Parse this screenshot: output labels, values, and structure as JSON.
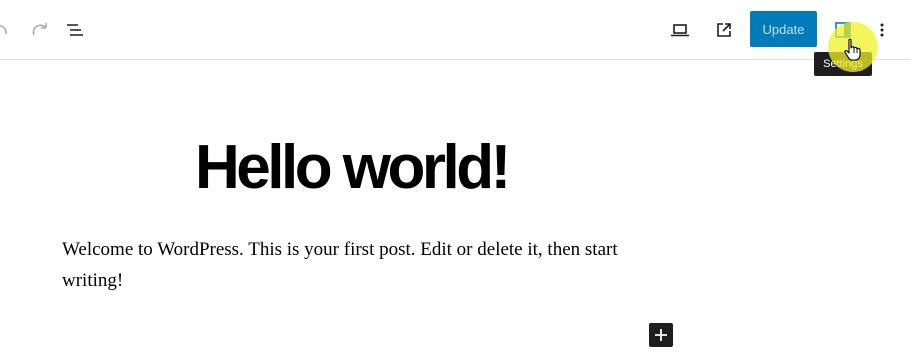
{
  "toolbar": {
    "update_label": "Update",
    "icons": {
      "undo": "undo-icon",
      "redo": "redo-icon",
      "document_overview": "list-view-icon",
      "preview": "laptop-icon",
      "view_post": "external-link-icon",
      "settings": "sidebar-panel-icon",
      "options": "more-vertical-icon"
    },
    "accent_color": "#007cba"
  },
  "tooltip": {
    "text": "Settings"
  },
  "post": {
    "title": "Hello world!",
    "body": "Welcome to WordPress. This is your first post. Edit or delete it, then start writing!"
  },
  "inserter": {
    "icon": "plus-icon"
  }
}
